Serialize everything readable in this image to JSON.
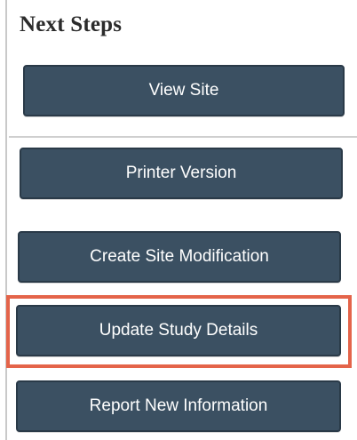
{
  "panel": {
    "title": "Next Steps",
    "buttons": [
      {
        "label": "View Site"
      },
      {
        "label": "Printer Version"
      },
      {
        "label": "Create Site Modification"
      },
      {
        "label": "Update Study Details"
      },
      {
        "label": "Report New Information"
      }
    ]
  },
  "colors": {
    "button_bg": "#3b5062",
    "highlight": "#e4644a"
  }
}
